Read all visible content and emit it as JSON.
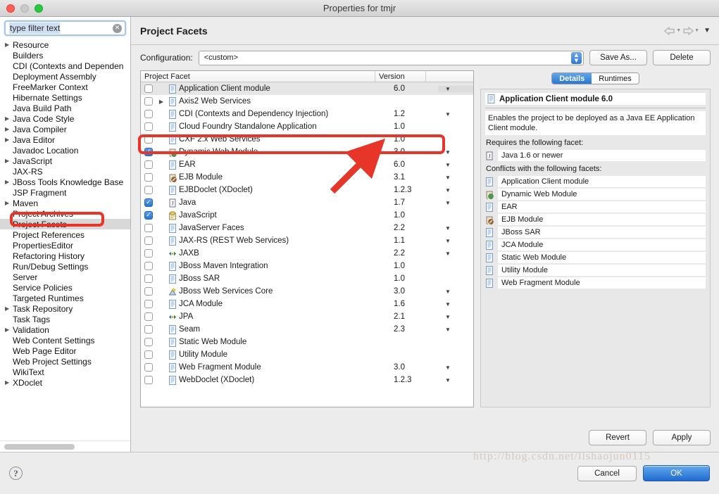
{
  "window": {
    "title": "Properties for tmjr"
  },
  "sidebar": {
    "filter": {
      "value": "type filter text",
      "placeholder": "type filter text",
      "clear_icon": "clear-circle-icon"
    },
    "items": [
      {
        "label": "Resource",
        "expandable": true
      },
      {
        "label": "Builders",
        "expandable": false
      },
      {
        "label": "CDI (Contexts and Dependen",
        "expandable": false
      },
      {
        "label": "Deployment Assembly",
        "expandable": false
      },
      {
        "label": "FreeMarker Context",
        "expandable": false
      },
      {
        "label": "Hibernate Settings",
        "expandable": false
      },
      {
        "label": "Java Build Path",
        "expandable": false
      },
      {
        "label": "Java Code Style",
        "expandable": true
      },
      {
        "label": "Java Compiler",
        "expandable": true
      },
      {
        "label": "Java Editor",
        "expandable": true
      },
      {
        "label": "Javadoc Location",
        "expandable": false
      },
      {
        "label": "JavaScript",
        "expandable": true
      },
      {
        "label": "JAX-RS",
        "expandable": false
      },
      {
        "label": "JBoss Tools Knowledge Base",
        "expandable": true
      },
      {
        "label": "JSP Fragment",
        "expandable": false
      },
      {
        "label": "Maven",
        "expandable": true
      },
      {
        "label": "Project Archives",
        "expandable": false
      },
      {
        "label": "Project Facets",
        "expandable": false,
        "selected": true
      },
      {
        "label": "Project References",
        "expandable": false
      },
      {
        "label": "PropertiesEditor",
        "expandable": false
      },
      {
        "label": "Refactoring History",
        "expandable": false
      },
      {
        "label": "Run/Debug Settings",
        "expandable": false
      },
      {
        "label": "Server",
        "expandable": false
      },
      {
        "label": "Service Policies",
        "expandable": false
      },
      {
        "label": "Targeted Runtimes",
        "expandable": false
      },
      {
        "label": "Task Repository",
        "expandable": true
      },
      {
        "label": "Task Tags",
        "expandable": false
      },
      {
        "label": "Validation",
        "expandable": true
      },
      {
        "label": "Web Content Settings",
        "expandable": false
      },
      {
        "label": "Web Page Editor",
        "expandable": false
      },
      {
        "label": "Web Project Settings",
        "expandable": false
      },
      {
        "label": "WikiText",
        "expandable": false
      },
      {
        "label": "XDoclet",
        "expandable": true
      }
    ]
  },
  "header": {
    "title": "Project Facets",
    "nav": {
      "back_icon": "back-arrow-icon",
      "forward_icon": "forward-arrow-icon",
      "menu_icon": "chevron-down-icon"
    }
  },
  "config": {
    "label": "Configuration:",
    "value": "<custom>",
    "save_as_label": "Save As...",
    "delete_label": "Delete"
  },
  "facet_table": {
    "columns": [
      "Project Facet",
      "Version",
      ""
    ],
    "rows": [
      {
        "name": "Application Client module",
        "version": "6.0",
        "checked": false,
        "dropdown": true,
        "expandable": false,
        "selected": true,
        "icon": "document-icon"
      },
      {
        "name": "Axis2 Web Services",
        "version": "",
        "checked": false,
        "dropdown": false,
        "expandable": true,
        "icon": "document-icon"
      },
      {
        "name": "CDI (Contexts and Dependency Injection)",
        "version": "1.2",
        "checked": false,
        "dropdown": true,
        "expandable": false,
        "icon": "document-icon"
      },
      {
        "name": "Cloud Foundry Standalone Application",
        "version": "1.0",
        "checked": false,
        "dropdown": false,
        "expandable": false,
        "icon": "document-icon"
      },
      {
        "name": "CXF 2.x Web Services",
        "version": "1.0",
        "checked": false,
        "dropdown": false,
        "expandable": false,
        "icon": "document-icon"
      },
      {
        "name": "Dynamic Web Module",
        "version": "3.0",
        "checked": true,
        "dropdown": true,
        "expandable": false,
        "icon": "web-module-icon"
      },
      {
        "name": "EAR",
        "version": "6.0",
        "checked": false,
        "dropdown": true,
        "expandable": false,
        "icon": "document-icon"
      },
      {
        "name": "EJB Module",
        "version": "3.1",
        "checked": false,
        "dropdown": true,
        "expandable": false,
        "icon": "ejb-module-icon"
      },
      {
        "name": "EJBDoclet (XDoclet)",
        "version": "1.2.3",
        "checked": false,
        "dropdown": true,
        "expandable": false,
        "icon": "document-icon"
      },
      {
        "name": "Java",
        "version": "1.7",
        "checked": true,
        "dropdown": true,
        "expandable": false,
        "icon": "java-icon"
      },
      {
        "name": "JavaScript",
        "version": "1.0",
        "checked": true,
        "dropdown": false,
        "expandable": false,
        "icon": "javascript-icon"
      },
      {
        "name": "JavaServer Faces",
        "version": "2.2",
        "checked": false,
        "dropdown": true,
        "expandable": false,
        "icon": "document-icon"
      },
      {
        "name": "JAX-RS (REST Web Services)",
        "version": "1.1",
        "checked": false,
        "dropdown": true,
        "expandable": false,
        "icon": "document-icon"
      },
      {
        "name": "JAXB",
        "version": "2.2",
        "checked": false,
        "dropdown": true,
        "expandable": false,
        "icon": "jaxb-icon"
      },
      {
        "name": "JBoss Maven Integration",
        "version": "1.0",
        "checked": false,
        "dropdown": false,
        "expandable": false,
        "icon": "document-icon"
      },
      {
        "name": "JBoss SAR",
        "version": "1.0",
        "checked": false,
        "dropdown": false,
        "expandable": false,
        "icon": "document-icon"
      },
      {
        "name": "JBoss Web Services Core",
        "version": "3.0",
        "checked": false,
        "dropdown": true,
        "expandable": false,
        "icon": "webservice-icon"
      },
      {
        "name": "JCA Module",
        "version": "1.6",
        "checked": false,
        "dropdown": true,
        "expandable": false,
        "icon": "document-icon"
      },
      {
        "name": "JPA",
        "version": "2.1",
        "checked": false,
        "dropdown": true,
        "expandable": false,
        "icon": "jaxb-icon"
      },
      {
        "name": "Seam",
        "version": "2.3",
        "checked": false,
        "dropdown": true,
        "expandable": false,
        "icon": "document-icon"
      },
      {
        "name": "Static Web Module",
        "version": "",
        "checked": false,
        "dropdown": false,
        "expandable": false,
        "icon": "document-icon"
      },
      {
        "name": "Utility Module",
        "version": "",
        "checked": false,
        "dropdown": false,
        "expandable": false,
        "icon": "document-icon"
      },
      {
        "name": "Web Fragment Module",
        "version": "3.0",
        "checked": false,
        "dropdown": true,
        "expandable": false,
        "icon": "document-icon"
      },
      {
        "name": "WebDoclet (XDoclet)",
        "version": "1.2.3",
        "checked": false,
        "dropdown": true,
        "expandable": false,
        "icon": "document-icon"
      }
    ]
  },
  "details": {
    "tabs": [
      {
        "label": "Details",
        "active": true
      },
      {
        "label": "Runtimes",
        "active": false
      }
    ],
    "facet_title": "Application Client module 6.0",
    "facet_title_icon": "document-icon",
    "description": "Enables the project to be deployed as a Java EE Application Client module.",
    "requires_label": "Requires the following facet:",
    "requires": [
      {
        "label": "Java 1.6 or newer",
        "icon": "java-icon"
      }
    ],
    "conflicts_label": "Conflicts with the following facets:",
    "conflicts": [
      {
        "label": "Application Client module",
        "icon": "document-icon"
      },
      {
        "label": "Dynamic Web Module",
        "icon": "web-module-icon"
      },
      {
        "label": "EAR",
        "icon": "document-icon"
      },
      {
        "label": "EJB Module",
        "icon": "ejb-module-icon"
      },
      {
        "label": "JBoss SAR",
        "icon": "document-icon"
      },
      {
        "label": "JCA Module",
        "icon": "document-icon"
      },
      {
        "label": "Static Web Module",
        "icon": "document-icon"
      },
      {
        "label": "Utility Module",
        "icon": "document-icon"
      },
      {
        "label": "Web Fragment Module",
        "icon": "document-icon"
      }
    ]
  },
  "actions": {
    "revert_label": "Revert",
    "apply_label": "Apply",
    "cancel_label": "Cancel",
    "ok_label": "OK",
    "help_label": "?"
  },
  "annotations": {
    "watermark": "http://blog.csdn.net/lishaojun0115",
    "highlight_color": "#e8352a",
    "boxes": [
      "sidebar-project-facets",
      "facet-row-dynamic-web-module"
    ],
    "arrow": "red-arrow-pointing-to-version"
  }
}
